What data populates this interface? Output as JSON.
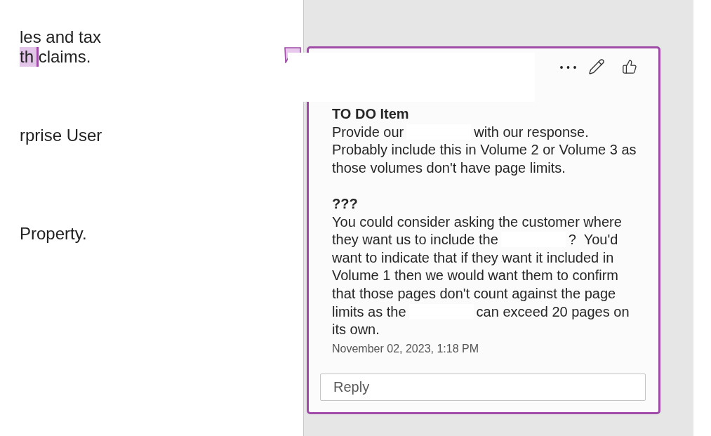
{
  "document": {
    "paragraphs": [
      {
        "lines": [
          {
            "segments": [
              {
                "text": "les and tax",
                "highlighted": false
              }
            ]
          },
          {
            "segments": [
              {
                "text": "th ",
                "highlighted": true
              },
              {
                "text": "claims.",
                "highlighted": false
              }
            ]
          }
        ]
      },
      {
        "lines": [
          {
            "segments": [
              {
                "text": "rprise User",
                "highlighted": false
              }
            ]
          }
        ]
      },
      {
        "lines": [
          {
            "segments": [
              {
                "text": "Property.",
                "highlighted": false
              }
            ]
          }
        ]
      }
    ]
  },
  "comment": {
    "paragraphs": [
      {
        "heading": "TO DO Item",
        "lines": [
          [
            "Provide our",
            "with our response."
          ],
          [
            "Probably include this in Volume 2 or Volume 3 as"
          ],
          [
            "those volumes don't have page limits."
          ]
        ]
      },
      {
        "heading": "???",
        "lines": [
          [
            "You could consider asking the customer where"
          ],
          [
            "they want us to include the",
            "?  You'd"
          ],
          [
            "want to indicate that if they want it included in"
          ],
          [
            "Volume 1 then we would want them to confirm"
          ],
          [
            "that those pages don't count against the page"
          ],
          [
            "limits as the",
            "can exceed 20 pages on"
          ],
          [
            "its own."
          ]
        ]
      }
    ],
    "timestamp": "November 02, 2023, 1:18 PM",
    "reply": {
      "placeholder": "Reply"
    }
  }
}
